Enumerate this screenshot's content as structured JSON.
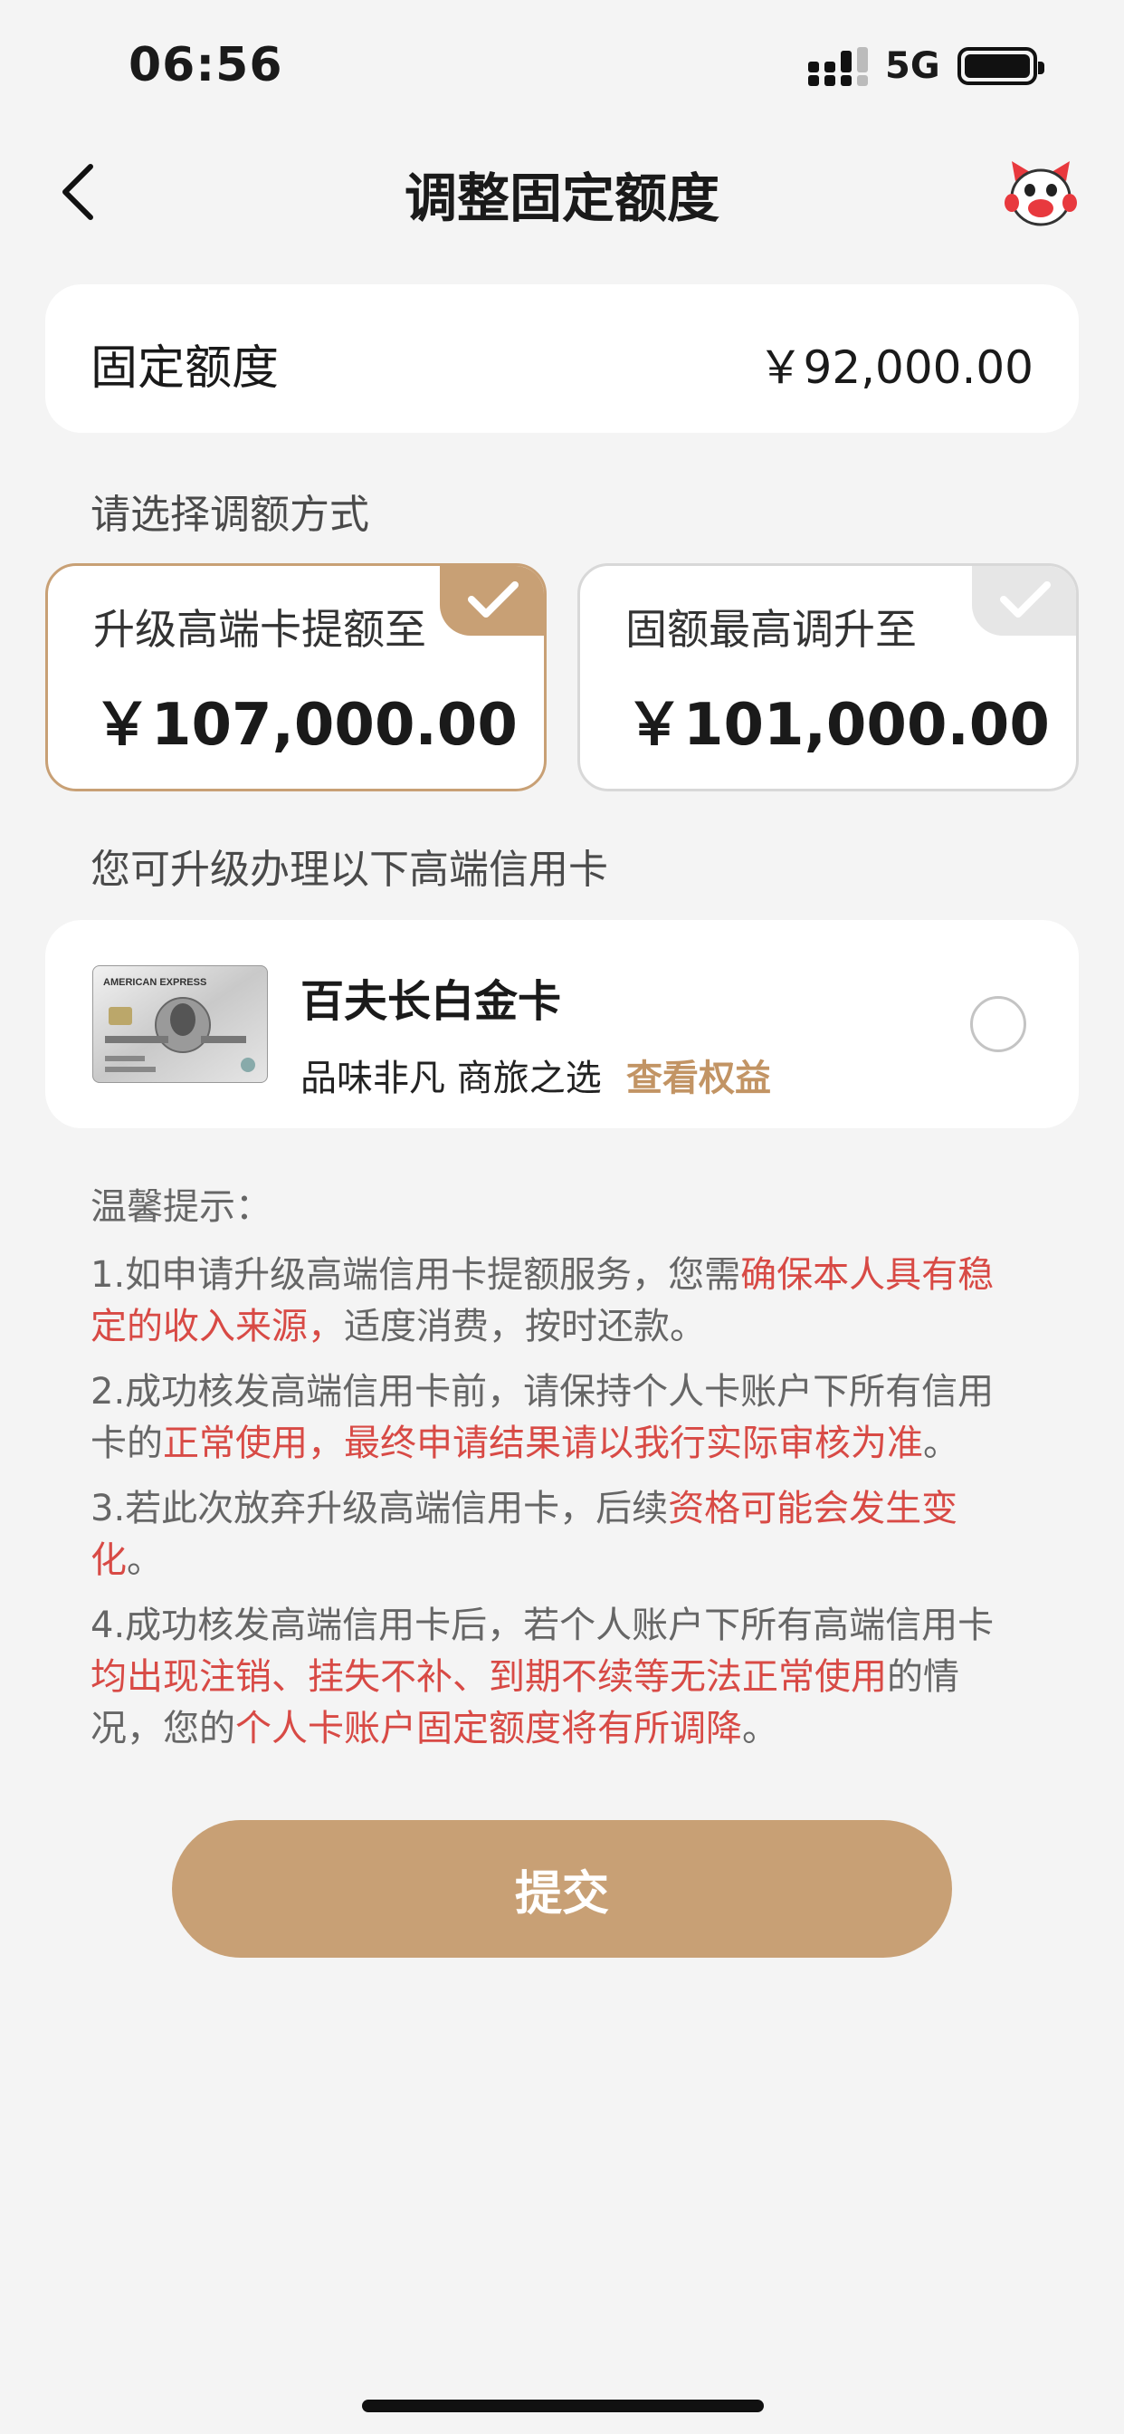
{
  "status_bar": {
    "time": "06:56",
    "network": "5G"
  },
  "nav": {
    "title": "调整固定额度",
    "back_icon": "chevron-left-icon",
    "mascot_icon": "mascot-icon"
  },
  "fixed_limit": {
    "label": "固定额度",
    "value": "￥92,000.00"
  },
  "choose_method_label": "请选择调额方式",
  "options": [
    {
      "label": "升级高端卡提额至",
      "value": "￥107,000.00",
      "selected": true
    },
    {
      "label": "固额最高调升至",
      "value": "￥101,000.00",
      "selected": false
    }
  ],
  "upgrade_section_label": "您可升级办理以下高端信用卡",
  "upgrade_card": {
    "name": "百夫长白金卡",
    "desc": "品味非凡 商旅之选",
    "link": "查看权益",
    "image_brand": "AMERICAN EXPRESS"
  },
  "tips": {
    "title": "温馨提示：",
    "items": [
      [
        {
          "t": "1.如申请升级高端信用卡提额服务，您需",
          "hl": false
        },
        {
          "t": "确保本人具有稳定的收入来源，",
          "hl": true
        },
        {
          "t": "适度消费，按时还款。",
          "hl": false
        }
      ],
      [
        {
          "t": "2.成功核发高端信用卡前，请保持个人卡账户下所有信用卡的",
          "hl": false
        },
        {
          "t": "正常使用，最终申请结果请以我行实际审核为准",
          "hl": true
        },
        {
          "t": "。",
          "hl": false
        }
      ],
      [
        {
          "t": "3.若此次放弃升级高端信用卡，后续",
          "hl": false
        },
        {
          "t": "资格可能会发生变化",
          "hl": true
        },
        {
          "t": "。",
          "hl": false
        }
      ],
      [
        {
          "t": "4.成功核发高端信用卡后，若个人账户下所有高端信用卡",
          "hl": false
        },
        {
          "t": "均出现注销、挂失不补、到期不续等无法正常使用",
          "hl": true
        },
        {
          "t": "的情况，您的",
          "hl": false
        },
        {
          "t": "个人卡账户固定额度将有所调降",
          "hl": true
        },
        {
          "t": "。",
          "hl": false
        }
      ]
    ]
  },
  "submit_label": "提交",
  "colors": {
    "accent": "#c8a075",
    "highlight": "#d84a45",
    "link": "#c29464"
  }
}
